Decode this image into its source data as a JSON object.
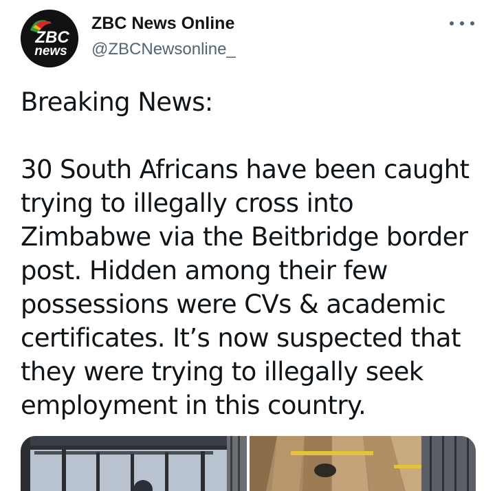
{
  "tweet": {
    "author": {
      "display_name": "ZBC News Online",
      "handle": "@ZBCNewsonline_",
      "avatar_logo_text_top": "ZBC",
      "avatar_logo_text_bottom": "news"
    },
    "more_icon": "more-horizontal-icon",
    "text_paragraphs": [
      "Breaking News:",
      "30 South Africans have been caught trying to illegally cross into Zimbabwe via the Beitbridge border post. Hidden among their few possessions were CVs & academic certificates. It’s now suspected that they were trying to illegally seek employment in this country."
    ],
    "media": [
      {
        "label": "photo-left"
      },
      {
        "label": "photo-right"
      }
    ]
  },
  "colors": {
    "text_primary": "#0f1419",
    "text_secondary": "#536471",
    "background": "#ffffff"
  }
}
